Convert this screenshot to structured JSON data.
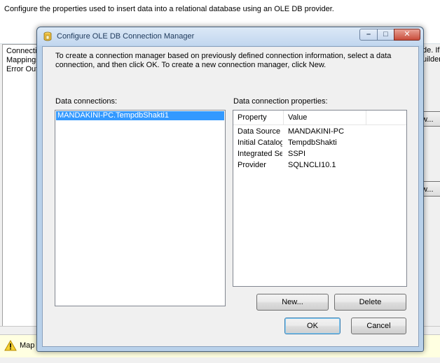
{
  "background": {
    "description": "Configure the properties used to insert data into a relational database using an OLE DB provider.",
    "nav_items": [
      "Connectio",
      "Mappings",
      "Error Outp"
    ],
    "right_text_1": "de. If",
    "right_text_2": "uilder",
    "button_1_label": "w...",
    "button_2_label": "w...",
    "status_message": "Map t"
  },
  "dialog": {
    "title": "Configure OLE DB Connection Manager",
    "intro": "To create a connection manager based on previously defined connection information, select a data connection, and then click OK. To create a new connection manager, click New.",
    "connections_label": "Data connections:",
    "connections": [
      "MANDAKINI-PC.TempdbShakti1"
    ],
    "properties_label": "Data connection properties:",
    "properties": {
      "columns": [
        "Property",
        "Value"
      ],
      "rows": [
        {
          "property": "Data Source",
          "value": "MANDAKINI-PC"
        },
        {
          "property": "Initial Catalog",
          "value": "TempdbShakti"
        },
        {
          "property": "Integrated Se...",
          "value": "SSPI"
        },
        {
          "property": "Provider",
          "value": "SQLNCLI10.1"
        }
      ]
    },
    "buttons": {
      "new": "New...",
      "delete": "Delete",
      "ok": "OK",
      "cancel": "Cancel"
    },
    "window_controls": {
      "minimize": "–",
      "maximize": "□",
      "close": "✕"
    }
  },
  "icons": {
    "title_icon": "cylinder-connection-icon",
    "warning_icon": "warning-triangle-icon"
  },
  "colors": {
    "selection": "#3399ff",
    "titlebar": "#c2d7ef",
    "close_button": "#c94c3a",
    "status_bar": "#ffffe1"
  }
}
